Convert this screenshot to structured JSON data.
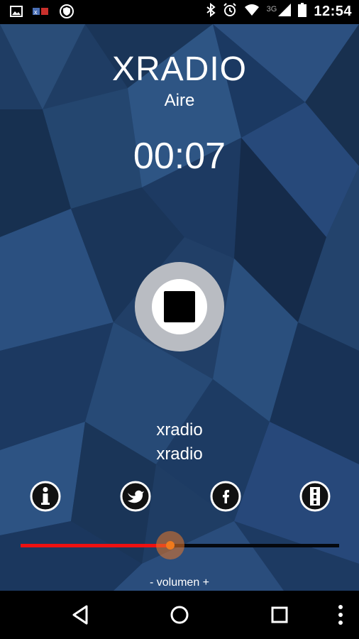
{
  "status_bar": {
    "time": "12:54",
    "network": "3G",
    "left_icons": [
      "image-icon",
      "bbm-icon",
      "shield-icon"
    ],
    "right_icons": [
      "bluetooth-icon",
      "alarm-icon",
      "wifi-icon",
      "signal-icon",
      "battery-icon"
    ]
  },
  "station": {
    "title": "XRADIO",
    "subtitle": "Aire"
  },
  "player": {
    "elapsed": "00:07",
    "state_button": "stop"
  },
  "track": {
    "line1": "xradio",
    "line2": "xradio"
  },
  "actions": [
    {
      "name": "info",
      "icon": "info-icon"
    },
    {
      "name": "twitter",
      "icon": "twitter-icon"
    },
    {
      "name": "facebook",
      "icon": "facebook-icon"
    },
    {
      "name": "more",
      "icon": "menu-icon"
    }
  ],
  "volume": {
    "label": "- volumen +",
    "level": 0.47,
    "fill_color": "#ee1111",
    "knob_color": "#f07a1c"
  },
  "navigation": [
    "back",
    "home",
    "recents",
    "overflow-menu"
  ],
  "colors": {
    "background": "#1f3d64",
    "text": "#ffffff",
    "stop_ring": "#b9bcc2"
  }
}
